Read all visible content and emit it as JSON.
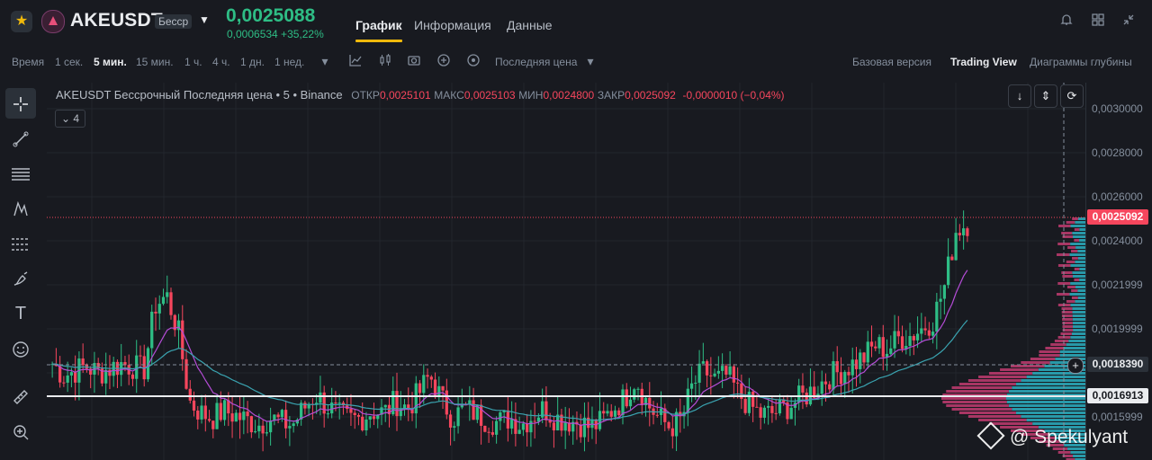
{
  "header": {
    "symbol": "AKEUSDT",
    "contract_badge": "Бесср",
    "last_price": "0,0025088",
    "change": "0,0006534 +35,22%",
    "tabs": [
      "График",
      "Информация",
      "Данные"
    ],
    "active_tab": "График"
  },
  "toolbar": {
    "intervals": [
      "Время",
      "1 сек.",
      "5 мин.",
      "15 мин.",
      "1 ч.",
      "4 ч.",
      "1 дн.",
      "1 нед."
    ],
    "active_interval": "5 мин.",
    "price_type": "Последняя цена",
    "views": [
      "Базовая версия",
      "Trading View",
      "Диаграммы глубины"
    ],
    "active_view": "Trading View"
  },
  "legend": {
    "title": "AKEUSDT Бессрочный Последняя цена • 5 • Binance",
    "open_label": "ОТКР",
    "open": "0,0025101",
    "high_label": "МАКС",
    "high": "0,0025103",
    "low_label": "МИН",
    "low": "0,0024800",
    "close_label": "ЗАКР",
    "close": "0,0025092",
    "change": "-0,0000010 (−0,04%)",
    "indicators_count": "4"
  },
  "axis": {
    "ticks": [
      "0,0030000",
      "0,0028000",
      "0,0026000",
      "0,0024000",
      "0,0021999",
      "0,0019999",
      "0,0015999"
    ]
  },
  "price_labels": {
    "last": "0,0025092",
    "crosshair": "0,0018390",
    "line": "0,0016913"
  },
  "watermark": "@ Spekulyant",
  "colors": {
    "up": "#2ebd85",
    "down": "#f6465d",
    "accent": "#f0b90b",
    "volume_up": "#2aa7b8",
    "volume_down": "#b83a6c",
    "ma_fast": "#b44cd6",
    "ma_slow": "#3aa3b0"
  },
  "chart_data": {
    "type": "candlestick",
    "ylim": [
      0.0015,
      0.003
    ],
    "close_series": [
      0.00191,
      0.00186,
      0.00188,
      0.0019,
      0.00187,
      0.00189,
      0.00191,
      0.0019,
      0.00188,
      0.00216,
      0.0022,
      0.00205,
      0.00175,
      0.0017,
      0.00168,
      0.00171,
      0.00169,
      0.00167,
      0.00165,
      0.00168,
      0.00166,
      0.00165,
      0.00172,
      0.00178,
      0.00173,
      0.00169,
      0.00167,
      0.00168,
      0.00171,
      0.0017,
      0.00175,
      0.00172,
      0.00178,
      0.00186,
      0.00176,
      0.00168,
      0.00172,
      0.0017,
      0.00167,
      0.00166,
      0.00168,
      0.00165,
      0.00169,
      0.00172,
      0.00168,
      0.00167,
      0.00166,
      0.00164,
      0.00166,
      0.00172,
      0.00176,
      0.00185,
      0.00174,
      0.00168,
      0.00164,
      0.00167,
      0.00182,
      0.00188,
      0.00184,
      0.00186,
      0.00178,
      0.00173,
      0.00169,
      0.0017,
      0.00172,
      0.00175,
      0.00178,
      0.00182,
      0.00186,
      0.00188,
      0.00191,
      0.00194,
      0.00199,
      0.00197,
      0.00202,
      0.00203,
      0.00206,
      0.0021,
      0.00224,
      0.00248,
      0.00251
    ]
  }
}
